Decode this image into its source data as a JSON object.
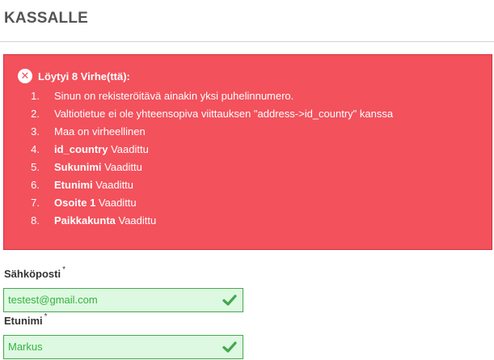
{
  "page": {
    "title": "KASSALLE"
  },
  "errors": {
    "icon": "error-x-icon",
    "icon_glyph": "✕",
    "heading": "Löytyi 8 Virhe(ttä):",
    "items": [
      {
        "num": "1.",
        "bold": "",
        "text": "Sinun on rekisteröitävä ainakin yksi puhelinnumero."
      },
      {
        "num": "2.",
        "bold": "",
        "text": "Valtiotietue ei ole yhteensopiva viittauksen \"address->id_country\" kanssa"
      },
      {
        "num": "3.",
        "bold": "",
        "text": "Maa on virheellinen"
      },
      {
        "num": "4.",
        "bold": "id_country",
        "text": " Vaadittu"
      },
      {
        "num": "5.",
        "bold": "Sukunimi",
        "text": " Vaadittu"
      },
      {
        "num": "6.",
        "bold": "Etunimi",
        "text": " Vaadittu"
      },
      {
        "num": "7.",
        "bold": "Osoite 1",
        "text": " Vaadittu"
      },
      {
        "num": "8.",
        "bold": "Paikkakunta",
        "text": " Vaadittu"
      }
    ]
  },
  "form": {
    "email": {
      "label": "Sähköposti",
      "required_mark": "*",
      "value": "testest@gmail.com",
      "status_icon": "check-icon"
    },
    "firstname": {
      "label": "Etunimi",
      "required_mark": "*",
      "value": "Markus",
      "status_icon": "check-icon"
    }
  },
  "colors": {
    "error_bg": "#f3515c",
    "valid_bg": "#ddf9e1",
    "valid_border": "#46a74e",
    "valid_text": "#35b33f"
  }
}
